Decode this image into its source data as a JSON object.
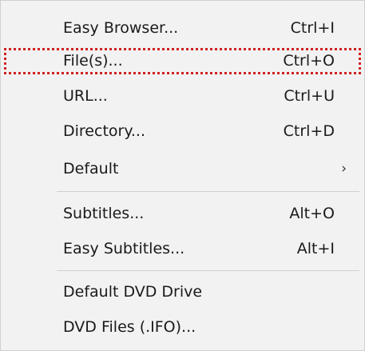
{
  "menu": {
    "items": [
      {
        "label": "Easy Browser...",
        "shortcut": "Ctrl+I"
      },
      {
        "label": "File(s)...",
        "shortcut": "Ctrl+O"
      },
      {
        "label": "URL...",
        "shortcut": "Ctrl+U"
      },
      {
        "label": "Directory...",
        "shortcut": "Ctrl+D"
      },
      {
        "label": "Default",
        "submenu_indicator": "›"
      },
      {
        "label": "Subtitles...",
        "shortcut": "Alt+O"
      },
      {
        "label": "Easy Subtitles...",
        "shortcut": "Alt+I"
      },
      {
        "label": "Default DVD Drive"
      },
      {
        "label": "DVD Files (.IFO)..."
      }
    ],
    "highlighted_item": "File(s)...",
    "highlight_color": "#d22020"
  }
}
